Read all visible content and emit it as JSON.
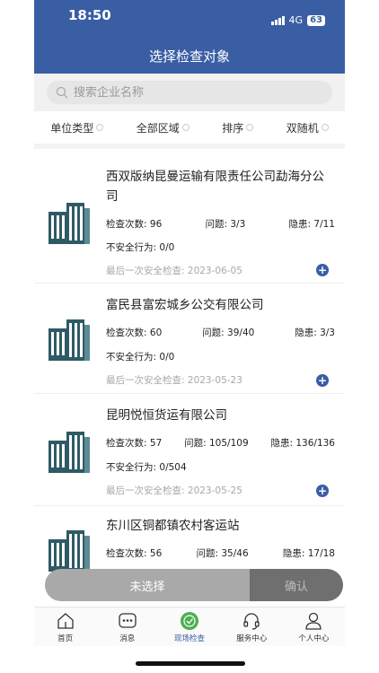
{
  "status": {
    "time": "18:50",
    "network": "4G",
    "battery": "63"
  },
  "header": {
    "title": "选择检查对象"
  },
  "search": {
    "placeholder": "搜索企业名称"
  },
  "filters": [
    "单位类型",
    "全部区域",
    "排序",
    "双随机"
  ],
  "labels": {
    "inspections": "检查次数:",
    "problems": "问题:",
    "hazards": "隐患:",
    "unsafe": "不安全行为:",
    "last_check": "最后一次安全检查:"
  },
  "companies": [
    {
      "name": "西双版纳昆曼运输有限责任公司勐海分公司",
      "inspections": "96",
      "problems": "3/3",
      "hazards": "7/11",
      "unsafe": "0/0",
      "last_check": "2023-06-05"
    },
    {
      "name": "富民县富宏城乡公交有限公司",
      "inspections": "60",
      "problems": "39/40",
      "hazards": "3/3",
      "unsafe": "0/0",
      "last_check": "2023-05-23"
    },
    {
      "name": "昆明悦恒货运有限公司",
      "inspections": "57",
      "problems": "105/109",
      "hazards": "136/136",
      "unsafe": "0/504",
      "last_check": "2023-05-25"
    },
    {
      "name": "东川区铜都镇农村客运站",
      "inspections": "56",
      "problems": "35/46",
      "hazards": "17/18",
      "unsafe": "",
      "last_check": ""
    }
  ],
  "actions": {
    "unselected": "未选择",
    "confirm": "确认"
  },
  "tabs": [
    {
      "label": "首页",
      "icon": "home-icon"
    },
    {
      "label": "消息",
      "icon": "message-icon"
    },
    {
      "label": "现场检查",
      "icon": "inspection-icon"
    },
    {
      "label": "服务中心",
      "icon": "headset-icon"
    },
    {
      "label": "个人中心",
      "icon": "user-icon"
    }
  ],
  "colors": {
    "primary": "#3a5ea4",
    "building": "#2e5a66"
  }
}
